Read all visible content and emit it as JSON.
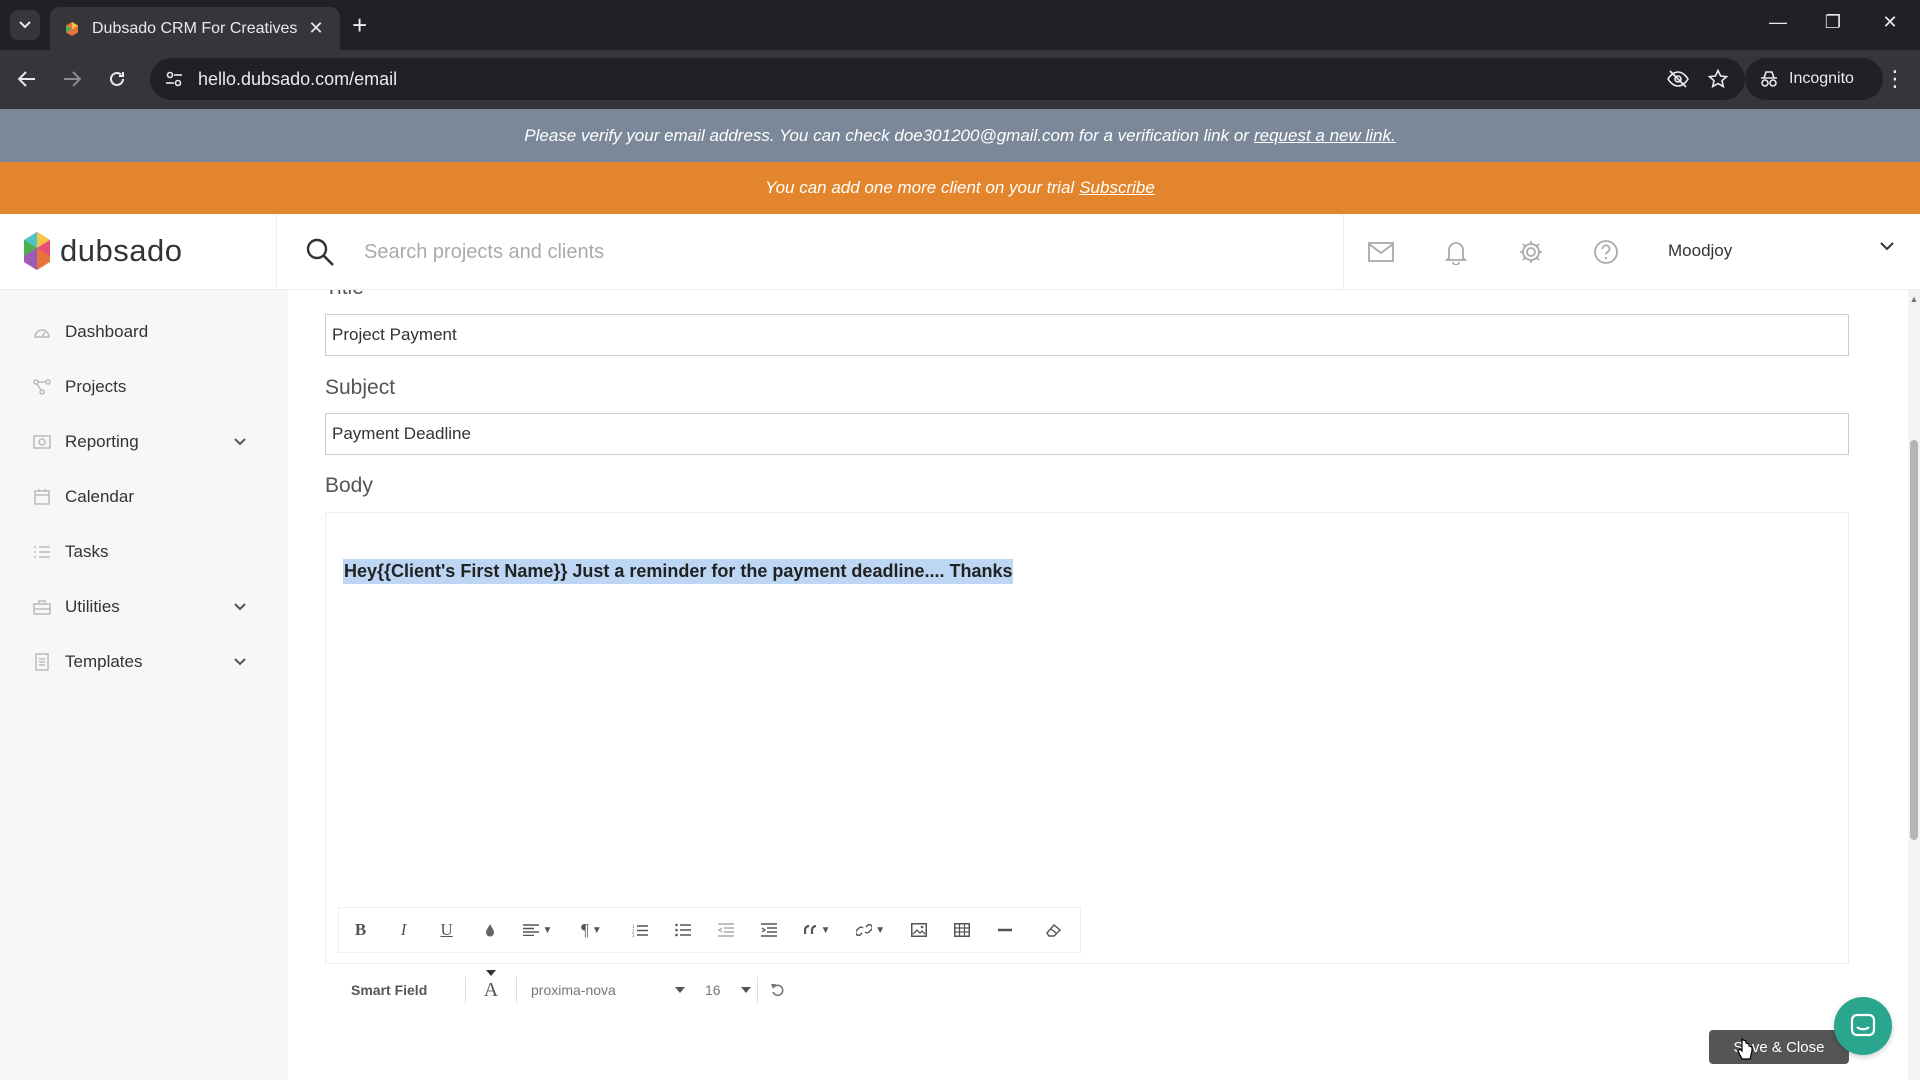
{
  "browser": {
    "tab_title": "Dubsado CRM For Creatives",
    "url": "hello.dubsado.com/email",
    "incognito_label": "Incognito"
  },
  "banners": {
    "verify_text": "Please verify your email address. You can check doe301200@gmail.com for a verification link or",
    "verify_link": "request a new link.",
    "trial_text": "You can add one more client on your trial",
    "trial_link": "Subscribe"
  },
  "header": {
    "logo_text": "dubsado",
    "search_placeholder": "Search projects and clients",
    "user_name": "Moodjoy"
  },
  "sidebar": {
    "items": [
      {
        "label": "Dashboard",
        "icon": "dashboard-icon"
      },
      {
        "label": "Projects",
        "icon": "projects-icon"
      },
      {
        "label": "Reporting",
        "icon": "reporting-icon"
      },
      {
        "label": "Calendar",
        "icon": "calendar-icon"
      },
      {
        "label": "Tasks",
        "icon": "tasks-icon"
      },
      {
        "label": "Utilities",
        "icon": "utilities-icon"
      },
      {
        "label": "Templates",
        "icon": "templates-icon"
      }
    ]
  },
  "form": {
    "title_label": "Title",
    "title_value": "Project Payment",
    "subject_label": "Subject",
    "subject_value": "Payment Deadline",
    "body_label": "Body",
    "body_text": "Hey{{Client's First Name}} Just a reminder for the payment deadline.... Thanks"
  },
  "editor": {
    "smart_field_label": "Smart Field",
    "font_family": "proxima-nova",
    "font_size": "16"
  },
  "actions": {
    "save_close_label": "Save & Close"
  },
  "colors": {
    "verify_banner": "#7a8899",
    "trial_banner": "#e3852c",
    "selection": "#bcd6f4",
    "chat": "#2aa58e"
  }
}
